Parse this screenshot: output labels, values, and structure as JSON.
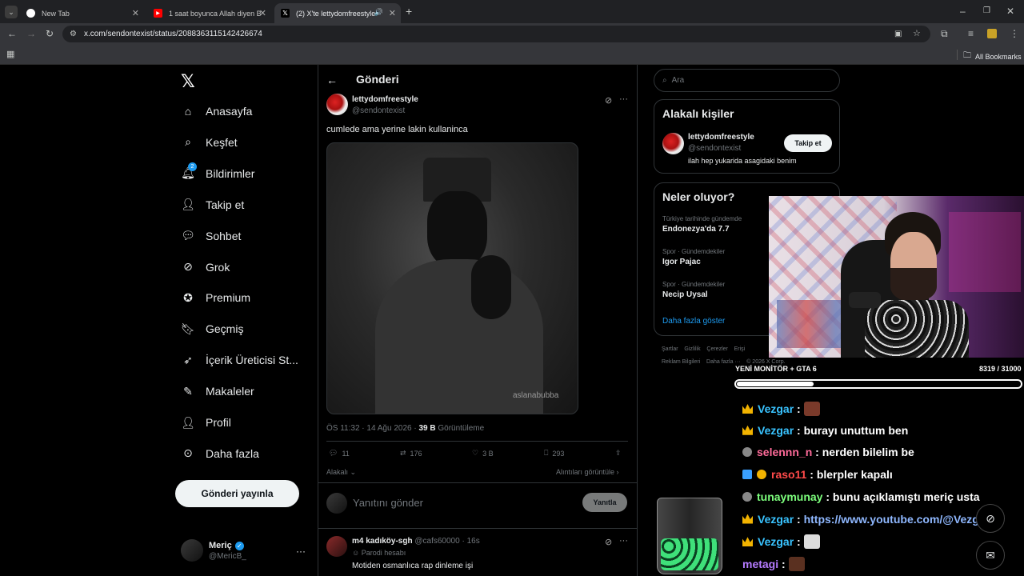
{
  "browser": {
    "tabs": [
      {
        "title": "New Tab",
        "icon": "chrome-icon"
      },
      {
        "title": "1 saat boyunca Allah diyen Bim",
        "icon": "youtube-icon"
      },
      {
        "title": "(2) X'te lettydomfreestyle: \"",
        "icon": "x-icon"
      }
    ],
    "url": "x.com/sendontexist/status/2088363115142426674",
    "bookmarks_label": "All Bookmarks"
  },
  "sidebar": {
    "items": [
      {
        "label": "Anasayfa",
        "icon": "home-icon"
      },
      {
        "label": "Keşfet",
        "icon": "search-icon"
      },
      {
        "label": "Bildirimler",
        "icon": "bell-icon",
        "badge": "2"
      },
      {
        "label": "Takip et",
        "icon": "follow-icon"
      },
      {
        "label": "Sohbet",
        "icon": "chat-icon"
      },
      {
        "label": "Grok",
        "icon": "grok-icon"
      },
      {
        "label": "Premium",
        "icon": "premium-icon"
      },
      {
        "label": "Geçmiş",
        "icon": "bookmark-icon"
      },
      {
        "label": "İçerik Üreticisi St...",
        "icon": "rocket-icon"
      },
      {
        "label": "Makaleler",
        "icon": "article-icon"
      },
      {
        "label": "Profil",
        "icon": "profile-icon"
      },
      {
        "label": "Daha fazla",
        "icon": "more-icon"
      }
    ],
    "post_button": "Gönderi yayınla",
    "account": {
      "name": "Meriç",
      "handle": "@MericB_"
    }
  },
  "post": {
    "header": "Gönderi",
    "author": {
      "name": "lettydomfreestyle",
      "handle": "@sendontexist"
    },
    "text": "cumlede ama yerine lakin kullaninca",
    "watermark": "aslanabubba",
    "meta_time": "ÖS 11:32 · 14 Ağu 2026 · ",
    "meta_views": "39 B",
    "meta_views_label": " Görüntüleme",
    "actions": {
      "replies": "11",
      "reposts": "176",
      "likes": "3 B",
      "bookmarks": "293"
    },
    "relevance": "Alakalı",
    "quotes_link": "Alıntıları görüntüle",
    "reply_placeholder": "Yanıtını gönder",
    "reply_button": "Yanıtla"
  },
  "reply": {
    "name": "m4 kadıköy-sgh",
    "handle": "@cafs60000",
    "time": "· 16s",
    "label": "Parodi hesabı",
    "text": "Motiden osmanlıca rap dinleme işi"
  },
  "right": {
    "search_placeholder": "Ara",
    "related_title": "Alakalı kişiler",
    "related_person": {
      "name": "lettydomfreestyle",
      "handle": "@sendontexist",
      "bio": "ilah hep yukarida asagidaki benim",
      "button": "Takip et"
    },
    "trends_title": "Neler oluyor?",
    "trends": [
      {
        "category": "Türkiye tarihinde gündemde",
        "name": "Endonezya'da 7.7"
      },
      {
        "category": "Spor · Gündemdekiler",
        "name": "Igor Pajac"
      },
      {
        "category": "Spor · Gündemdekiler",
        "name": "Necip Uysal"
      }
    ],
    "show_more": "Daha fazla göster",
    "footer_row1": "Şartlar    Gizlilik    Çerezler    Erişi",
    "footer_row2": "Reklam Bilgileri    Daha fazla ···    © 2026 X Corp."
  },
  "stream": {
    "goal_label": "YENİ MONİTÖR + GTA 6",
    "goal_count": "8319 / 31000",
    "goal_progress": 0.27,
    "chat": [
      {
        "user": "Vezgar",
        "color": "#39c3ff",
        "badge": "crown",
        "msg": ""
      },
      {
        "user": "Vezgar",
        "color": "#39c3ff",
        "badge": "crown",
        "msg": "burayı unuttum ben"
      },
      {
        "user": "selennn_n",
        "color": "#ff6b9a",
        "badge": "round",
        "msg": "nerden bilelim be"
      },
      {
        "user": "raso11",
        "color": "#ff4a4a",
        "badge": "cube",
        "msg": "blerpler kapalı"
      },
      {
        "user": "tunaymunay",
        "color": "#7dff7d",
        "badge": "round",
        "msg": "bunu açıklamıştı meriç usta"
      },
      {
        "user": "Vezgar",
        "color": "#39c3ff",
        "badge": "crown",
        "msg": "https://www.youtube.com/@Vezgar"
      },
      {
        "user": "Vezgar",
        "color": "#39c3ff",
        "badge": "crown",
        "msg": ""
      },
      {
        "user": "metagi",
        "color": "#b57bff",
        "badge": "none",
        "msg": ""
      }
    ]
  }
}
